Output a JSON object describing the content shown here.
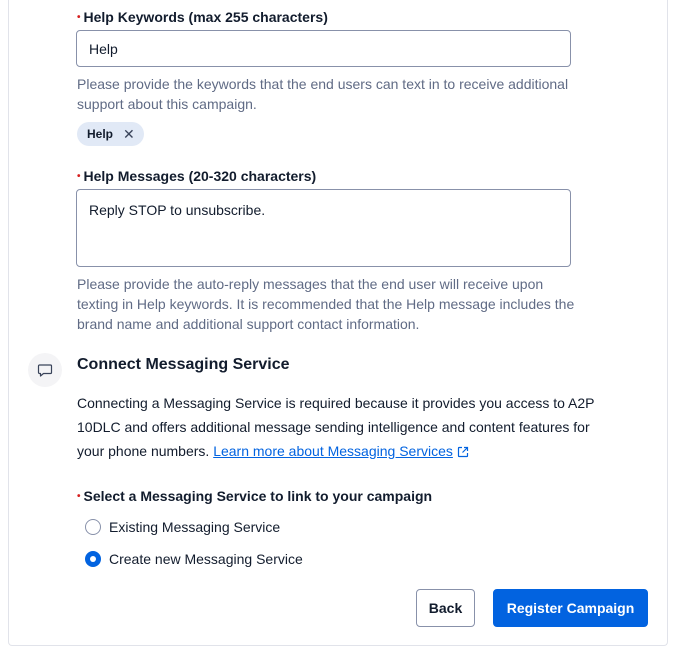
{
  "help_keywords": {
    "label": "Help Keywords (max 255 characters)",
    "value": "Help",
    "help_text": "Please provide the keywords that the end users can text in to receive additional support about this campaign.",
    "chips": [
      {
        "label": "Help",
        "remove_glyph": "✕"
      }
    ]
  },
  "help_messages": {
    "label": "Help Messages (20-320 characters)",
    "value": "Reply STOP to unsubscribe.",
    "help_text": "Please provide the auto-reply messages that the end user will receive upon texting in Help keywords. It is recommended that the Help message includes the brand name and additional support contact information."
  },
  "messaging_service": {
    "icon": "chat-bubble-icon",
    "title": "Connect Messaging Service",
    "description": "Connecting a Messaging Service is required because it provides you access to A2P 10DLC and offers additional message sending intelligence and content features for your phone numbers.",
    "link_text": "Learn more about Messaging Services",
    "select_label": "Select a Messaging Service to link to your campaign",
    "options": [
      {
        "label": "Existing Messaging Service",
        "checked": false
      },
      {
        "label": "Create new Messaging Service",
        "checked": true
      }
    ]
  },
  "actions": {
    "back_label": "Back",
    "register_label": "Register Campaign"
  },
  "colors": {
    "primary": "#0263e0",
    "required": "#d61f1f",
    "help_text": "#606b85",
    "chip_bg": "#e1e9f6"
  }
}
